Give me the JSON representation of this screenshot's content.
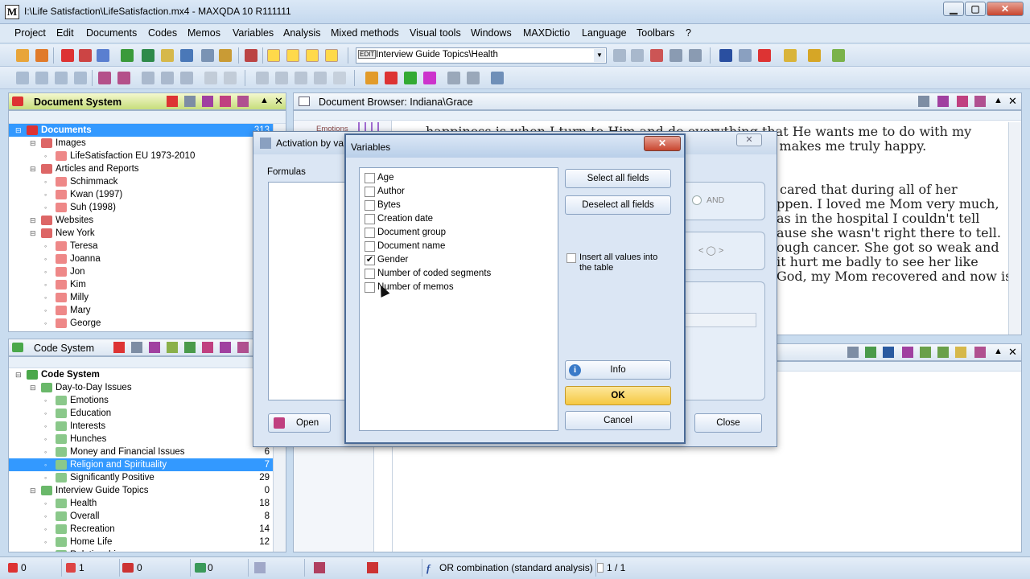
{
  "window": {
    "title": "I:\\Life Satisfaction\\LifeSatisfaction.mx4 - MAXQDA 10  R111111",
    "controls": {
      "minimize": "▁",
      "maximize": "▢",
      "close": "✕"
    }
  },
  "menu": [
    "Project",
    "Edit",
    "Documents",
    "Codes",
    "Memos",
    "Variables",
    "Analysis",
    "Mixed methods",
    "Visual tools",
    "Windows",
    "MAXDictio",
    "Language",
    "Toolbars",
    "?"
  ],
  "toolbar": {
    "combo_tag": "EDIT",
    "combo_value": "Interview Guide Topics\\Health"
  },
  "document_system": {
    "title": "Document System",
    "items": [
      {
        "label": "Documents",
        "count": "313",
        "level": 0,
        "selected": true
      },
      {
        "label": "Images",
        "level": 1
      },
      {
        "label": "LifeSatisfaction EU 1973-2010",
        "level": 2
      },
      {
        "label": "Articles and Reports",
        "level": 1
      },
      {
        "label": "Schimmack",
        "level": 2
      },
      {
        "label": "Kwan (1997)",
        "level": 2
      },
      {
        "label": "Suh (1998)",
        "level": 2
      },
      {
        "label": "Websites",
        "level": 1
      },
      {
        "label": "New York",
        "level": 1
      },
      {
        "label": "Teresa",
        "level": 2
      },
      {
        "label": "Joanna",
        "level": 2
      },
      {
        "label": "Jon",
        "level": 2
      },
      {
        "label": "Kim",
        "level": 2
      },
      {
        "label": "Milly",
        "level": 2
      },
      {
        "label": "Mary",
        "level": 2
      },
      {
        "label": "George",
        "level": 2
      }
    ]
  },
  "code_system": {
    "title": "Code System",
    "items": [
      {
        "label": "Code System",
        "count": "",
        "level": 0
      },
      {
        "label": "Day-to-Day Issues",
        "count": "",
        "level": 1
      },
      {
        "label": "Emotions",
        "count": "",
        "level": 2
      },
      {
        "label": "Education",
        "count": "",
        "level": 2
      },
      {
        "label": "Interests",
        "count": "",
        "level": 2
      },
      {
        "label": "Hunches",
        "count": "",
        "level": 2
      },
      {
        "label": "Money and Financial Issues",
        "count": "6",
        "level": 2
      },
      {
        "label": "Religion and Spirituality",
        "count": "7",
        "level": 2,
        "selected": true
      },
      {
        "label": "Significantly Positive",
        "count": "29",
        "level": 2
      },
      {
        "label": "Interview Guide Topics",
        "count": "0",
        "level": 1
      },
      {
        "label": "Health",
        "count": "18",
        "level": 2
      },
      {
        "label": "Overall",
        "count": "8",
        "level": 2
      },
      {
        "label": "Recreation",
        "count": "14",
        "level": 2
      },
      {
        "label": "Home Life",
        "count": "12",
        "level": 2
      },
      {
        "label": "Relationships",
        "count": "",
        "level": 2
      }
    ]
  },
  "document_browser": {
    "title": "Document Browser: Indiana\\Grace",
    "code_label": "Emotions",
    "lines": [
      "happiness is when I turn to Him and do everything that He wants me to do with my",
      "n makes me truly happy.",
      "cared that during all of her",
      "ppen. I loved me Mom very much,",
      "as in the hospital I couldn't tell",
      "ause she wasn't right there to tell.",
      "ough cancer. She got so weak and",
      "it hurt me badly to see her like",
      "God, my Mom recovered and now is"
    ]
  },
  "activation_dialog": {
    "title": "Activation by va",
    "formulas_label": "Formulas",
    "and_label": "AND",
    "open_label": "Open",
    "close_label": "Close"
  },
  "variables_dialog": {
    "title": "Variables",
    "variables": [
      {
        "label": "Age",
        "checked": false
      },
      {
        "label": "Author",
        "checked": false
      },
      {
        "label": "Bytes",
        "checked": false
      },
      {
        "label": "Creation date",
        "checked": false
      },
      {
        "label": "Document group",
        "checked": false
      },
      {
        "label": "Document name",
        "checked": false
      },
      {
        "label": "Gender",
        "checked": true
      },
      {
        "label": "Number of coded segments",
        "checked": false
      },
      {
        "label": "Number of memos",
        "checked": false
      }
    ],
    "select_all": "Select all fields",
    "deselect_all": "Deselect all fields",
    "insert_all": "Insert all values into the table",
    "info": "Info",
    "ok": "OK",
    "cancel": "Cancel"
  },
  "statusbar": {
    "docs": "0",
    "codes": "1",
    "memos": "0",
    "activated": "0",
    "mode": "OR combination (standard analysis)",
    "page": "1 / 1"
  }
}
